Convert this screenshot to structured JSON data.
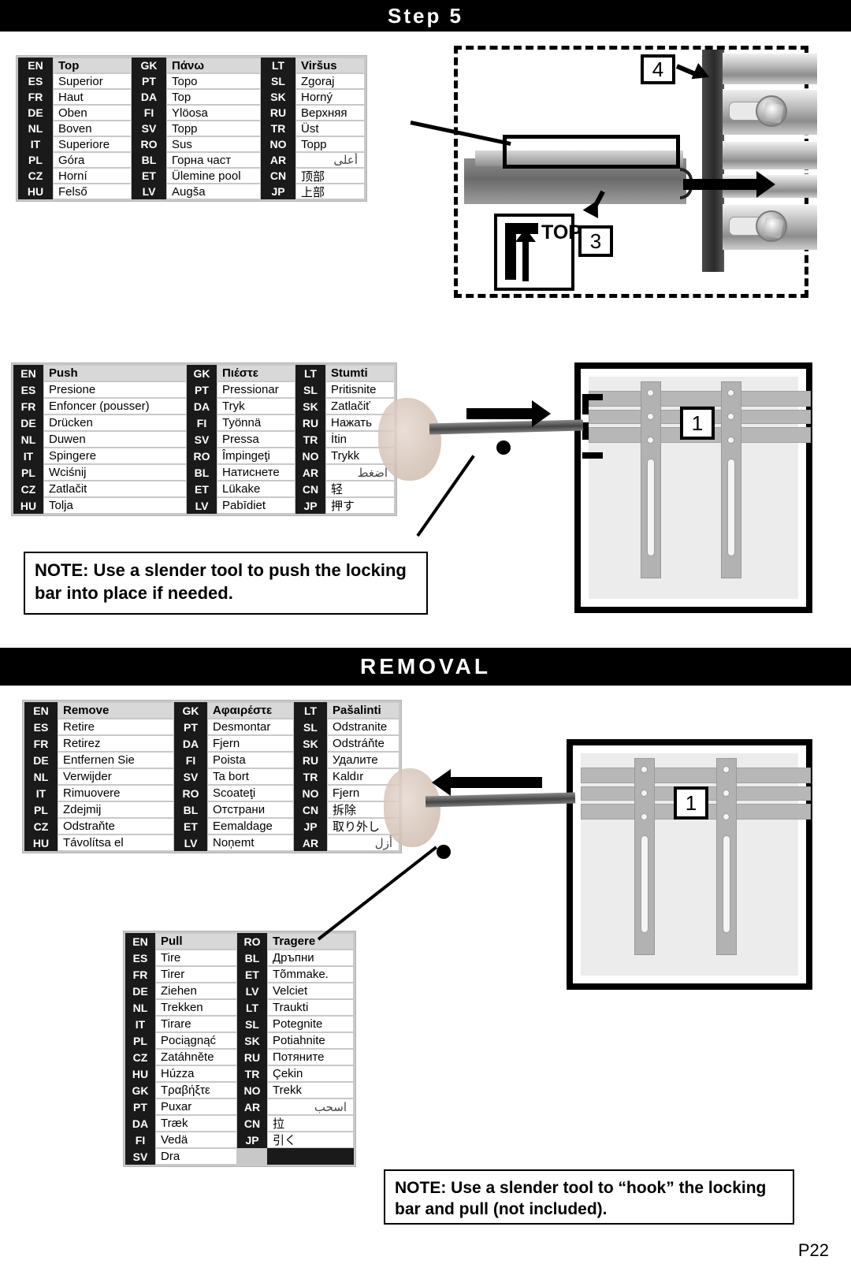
{
  "headers": {
    "step": "Step 5",
    "removal": "REMOVAL"
  },
  "page_number": "P22",
  "tables": {
    "top": {
      "title": "Top",
      "rows": [
        [
          "EN",
          "Top",
          "GK",
          "Πάνω",
          "LT",
          "Viršus"
        ],
        [
          "ES",
          "Superior",
          "PT",
          "Topo",
          "SL",
          "Zgoraj"
        ],
        [
          "FR",
          "Haut",
          "DA",
          "Top",
          "SK",
          "Horný"
        ],
        [
          "DE",
          "Oben",
          "FI",
          "Ylöosa",
          "RU",
          "Верхняя"
        ],
        [
          "NL",
          "Boven",
          "SV",
          "Topp",
          "TR",
          "Üst"
        ],
        [
          "IT",
          "Superiore",
          "RO",
          "Sus",
          "NO",
          "Topp"
        ],
        [
          "PL",
          "Góra",
          "BL",
          "Горна част",
          "AR",
          "أعلى"
        ],
        [
          "CZ",
          "Horní",
          "ET",
          "Ülemine pool",
          "CN",
          "顶部"
        ],
        [
          "HU",
          "Felső",
          "LV",
          "Augša",
          "JP",
          "上部"
        ]
      ]
    },
    "push": {
      "title": "Push",
      "rows": [
        [
          "EN",
          "Push",
          "GK",
          "Πιέστε",
          "LT",
          "Stumti"
        ],
        [
          "ES",
          "Presione",
          "PT",
          "Pressionar",
          "SL",
          "Pritisnite"
        ],
        [
          "FR",
          "Enfoncer (pousser)",
          "DA",
          "Tryk",
          "SK",
          "Zatlačiť"
        ],
        [
          "DE",
          "Drücken",
          "FI",
          "Työnnä",
          "RU",
          "Нажать"
        ],
        [
          "NL",
          "Duwen",
          "SV",
          "Pressa",
          "TR",
          "İtin"
        ],
        [
          "IT",
          "Spingere",
          "RO",
          "Împingeţi",
          "NO",
          "Trykk"
        ],
        [
          "PL",
          "Wciśnij",
          "BL",
          "Натиcнете",
          "AR",
          "اضغط"
        ],
        [
          "CZ",
          "Zatlačit",
          "ET",
          "Lükake",
          "CN",
          "轻"
        ],
        [
          "HU",
          "Tolja",
          "LV",
          "Pabīdiet",
          "JP",
          "押す"
        ]
      ]
    },
    "remove": {
      "title": "Remove",
      "rows": [
        [
          "EN",
          "Remove",
          "GK",
          "Αφαιρέστε",
          "LT",
          "Pašalinti"
        ],
        [
          "ES",
          "Retire",
          "PT",
          "Desmontar",
          "SL",
          "Odstranite"
        ],
        [
          "FR",
          "Retirez",
          "DA",
          "Fjern",
          "SK",
          "Odstráňte"
        ],
        [
          "DE",
          "Entfernen Sie",
          "FI",
          "Poista",
          "RU",
          "Удалите"
        ],
        [
          "NL",
          "Verwijder",
          "SV",
          "Ta bort",
          "TR",
          "Kaldır"
        ],
        [
          "IT",
          "Rimuovere",
          "RO",
          "Scoateţi",
          "NO",
          "Fjern"
        ],
        [
          "PL",
          "Zdejmij",
          "BL",
          "Отстрани",
          "CN",
          "拆除"
        ],
        [
          "CZ",
          "Odstraňte",
          "ET",
          "Eemaldage",
          "JP",
          "取り外し"
        ],
        [
          "HU",
          "Távolítsa el",
          "LV",
          "Noņemt",
          "AR",
          "أزل"
        ]
      ]
    },
    "pull": {
      "title": "Pull",
      "rows": [
        [
          "EN",
          "Pull",
          "RO",
          "Tragere"
        ],
        [
          "ES",
          "Tire",
          "BL",
          "Дръпни"
        ],
        [
          "FR",
          "Tirer",
          "ET",
          "Tõmmake."
        ],
        [
          "DE",
          "Ziehen",
          "LV",
          "Velciet"
        ],
        [
          "NL",
          "Trekken",
          "LT",
          "Traukti"
        ],
        [
          "IT",
          "Tirare",
          "SL",
          "Potegnite"
        ],
        [
          "PL",
          "Pociągnąć",
          "SK",
          "Potiahnite"
        ],
        [
          "CZ",
          "Zatáhněte",
          "RU",
          "Потяните"
        ],
        [
          "HU",
          "Húzza",
          "TR",
          "Çekin"
        ],
        [
          "GK",
          "Τραβήξτε",
          "NO",
          "Trekk"
        ],
        [
          "PT",
          "Puxar",
          "AR",
          "اسحب"
        ],
        [
          "DA",
          "Træk",
          "CN",
          "拉"
        ],
        [
          "FI",
          "Vedä",
          "JP",
          "引く"
        ],
        [
          "SV",
          "Dra",
          "",
          ""
        ]
      ]
    }
  },
  "notes": {
    "push_note": "NOTE: Use a slender tool to push the locking bar into place if needed.",
    "pull_note": "NOTE:  Use a slender tool to “hook” the locking bar and pull (not included)."
  },
  "callouts": {
    "step_four": "4",
    "step_three": "3",
    "bracket_one_push": "1",
    "bracket_one_remove": "1",
    "top_label": "TOP"
  },
  "colors": {
    "bar_background": "#000000",
    "bar_text": "#ffffff",
    "code_background": "#1a1a1a",
    "table_background": "#c8c8c8",
    "header_cell": "#d8d8d8"
  }
}
